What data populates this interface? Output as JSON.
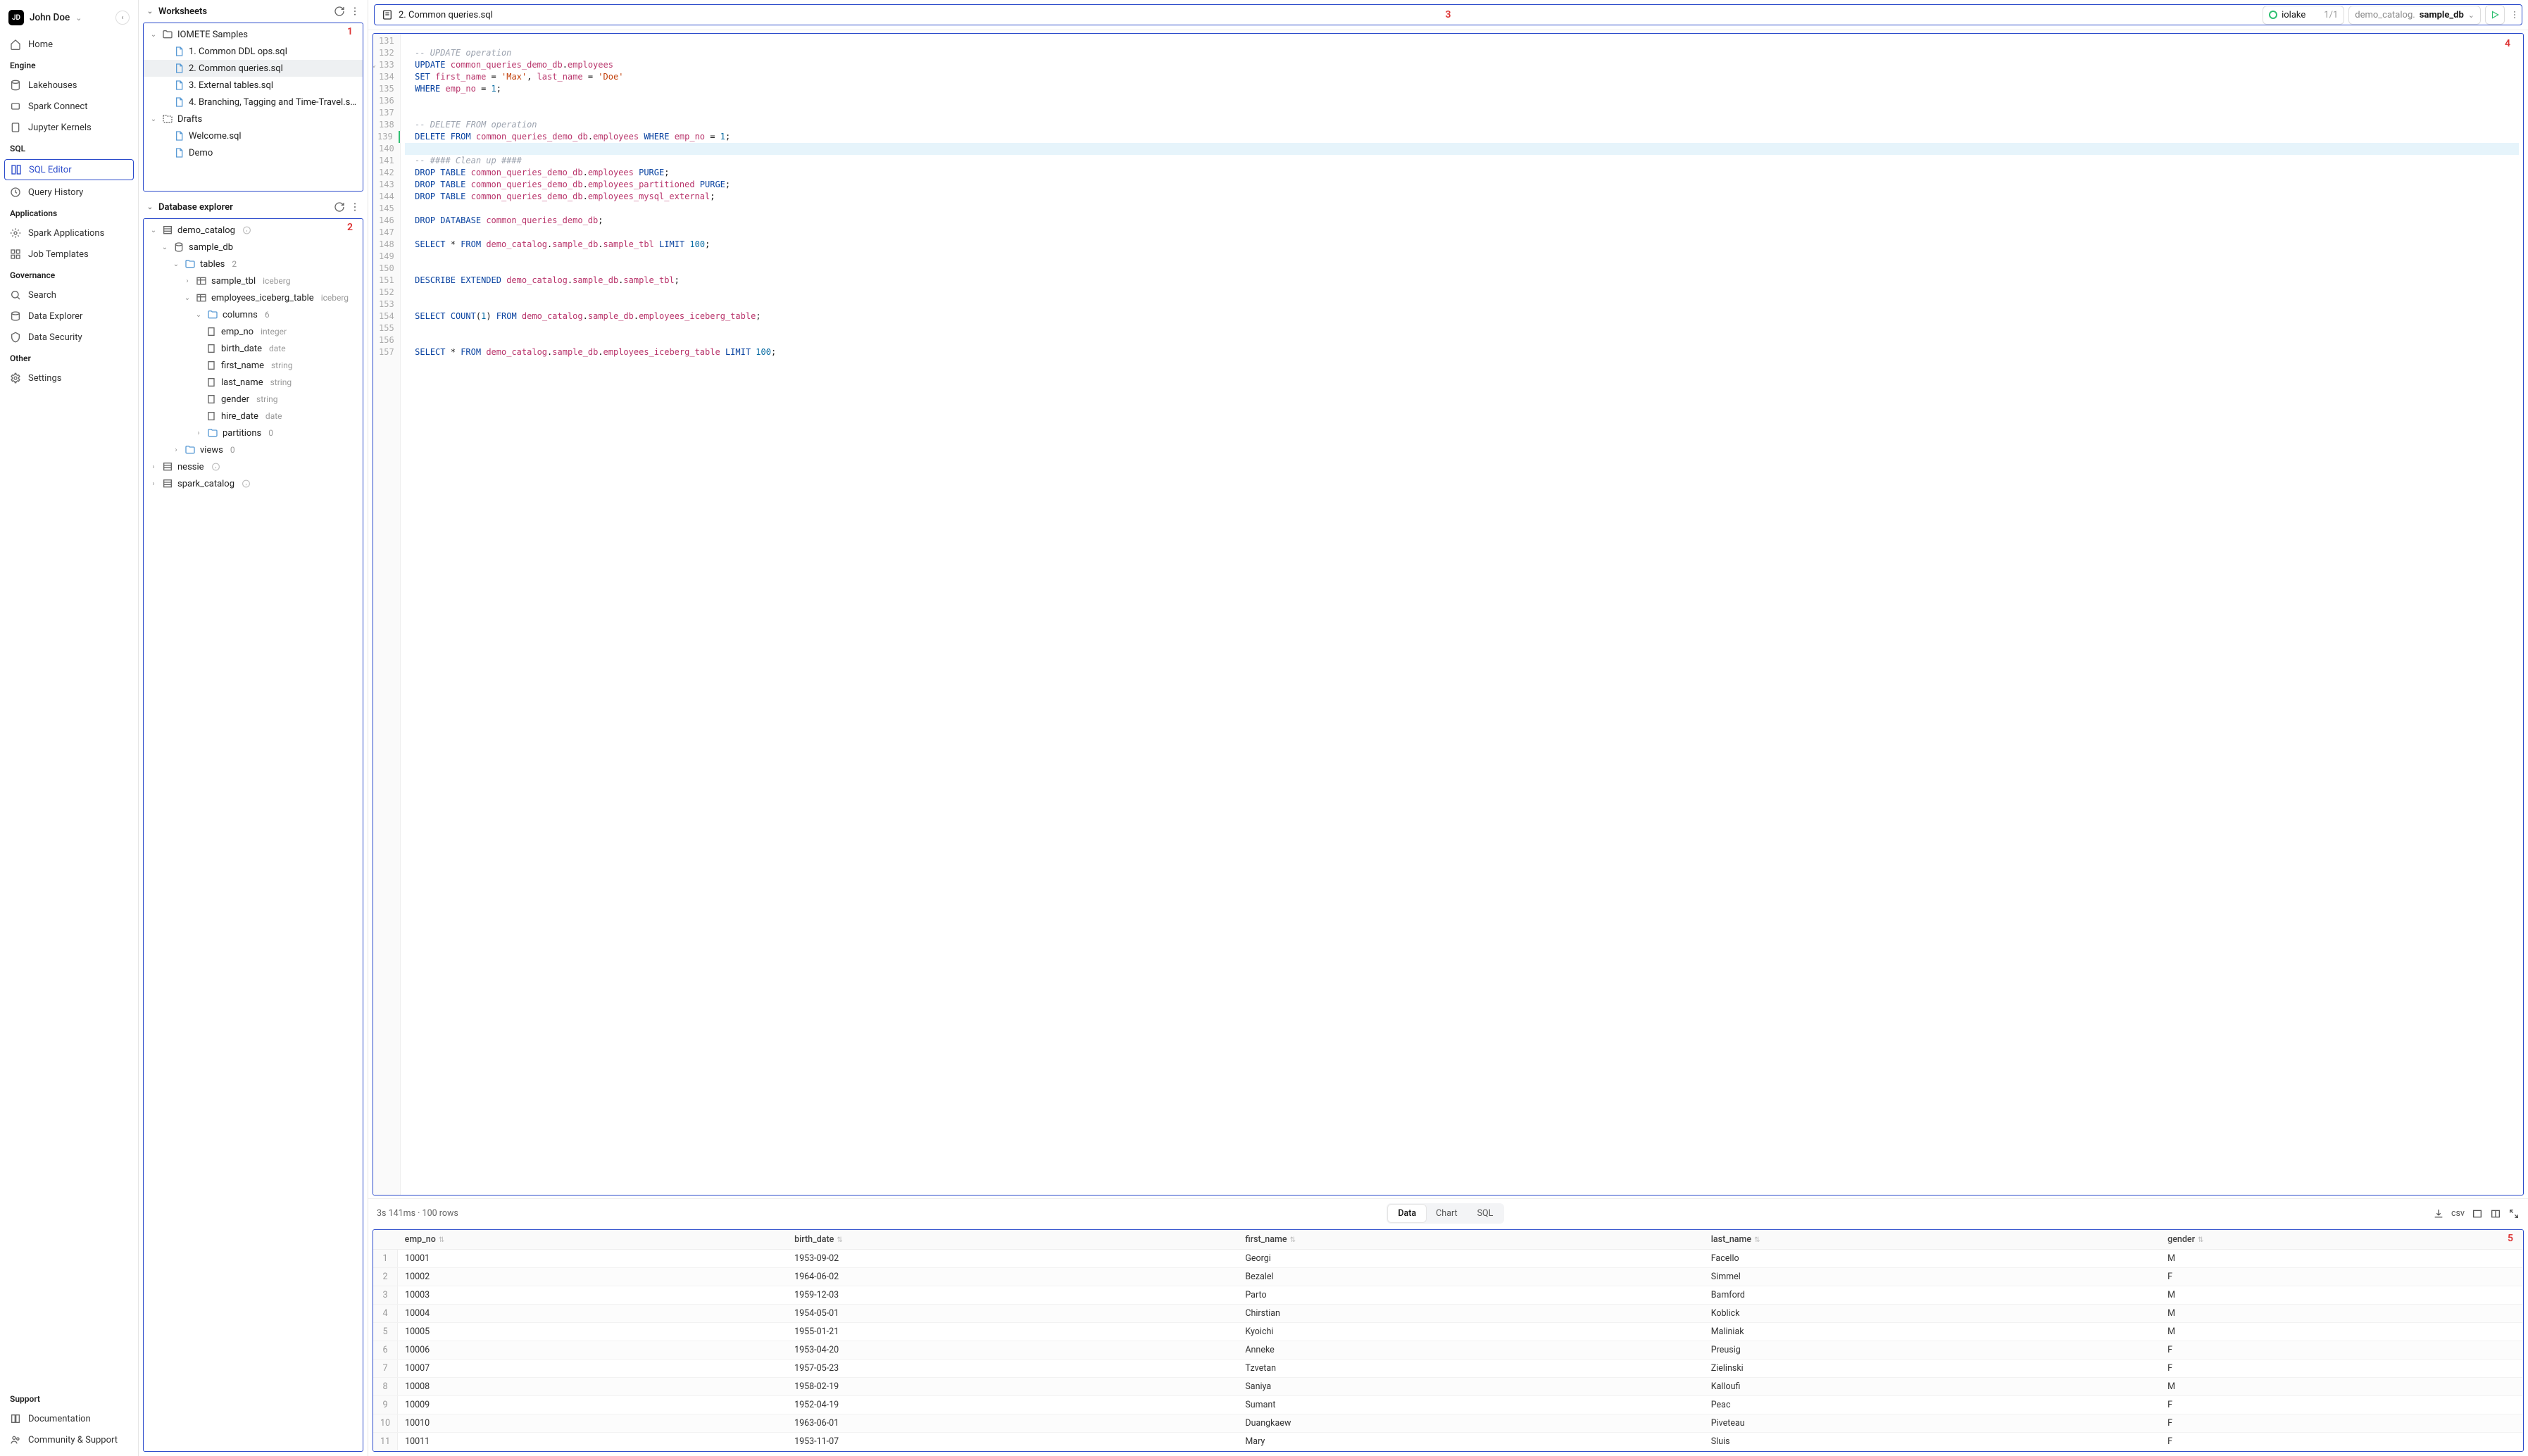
{
  "user": {
    "initials": "JD",
    "name": "John Doe"
  },
  "nav": {
    "home": "Home",
    "sections": {
      "engine": "Engine",
      "sql": "SQL",
      "applications": "Applications",
      "governance": "Governance",
      "other": "Other",
      "support": "Support"
    },
    "items": {
      "lakehouses": "Lakehouses",
      "spark_connect": "Spark Connect",
      "jupyter": "Jupyter Kernels",
      "sql_editor": "SQL Editor",
      "query_history": "Query History",
      "spark_apps": "Spark Applications",
      "job_templates": "Job Templates",
      "search": "Search",
      "data_explorer": "Data Explorer",
      "data_security": "Data Security",
      "settings": "Settings",
      "documentation": "Documentation",
      "community": "Community & Support"
    }
  },
  "worksheets": {
    "title": "Worksheets",
    "annot": "1",
    "folder": "IOMETE Samples",
    "files": [
      "1. Common DDL ops.sql",
      "2. Common queries.sql",
      "3. External tables.sql",
      "4. Branching, Tagging and Time-Travel.sql"
    ],
    "drafts_label": "Drafts",
    "drafts": [
      "Welcome.sql",
      "Demo"
    ]
  },
  "dbexplorer": {
    "title": "Database explorer",
    "annot": "2",
    "catalogs": {
      "demo": "demo_catalog",
      "nessie": "nessie",
      "spark": "spark_catalog"
    },
    "db": "sample_db",
    "tables_label": "tables",
    "tables_count": "2",
    "sample_tbl": "sample_tbl",
    "sample_tbl_type": "iceberg",
    "emp_tbl": "employees_iceberg_table",
    "emp_tbl_type": "iceberg",
    "columns_label": "columns",
    "columns_count": "6",
    "cols": [
      {
        "n": "emp_no",
        "t": "integer"
      },
      {
        "n": "birth_date",
        "t": "date"
      },
      {
        "n": "first_name",
        "t": "string"
      },
      {
        "n": "last_name",
        "t": "string"
      },
      {
        "n": "gender",
        "t": "string"
      },
      {
        "n": "hire_date",
        "t": "date"
      }
    ],
    "partitions_label": "partitions",
    "partitions_count": "0",
    "views_label": "views",
    "views_count": "0"
  },
  "toolbar": {
    "active_file": "2. Common queries.sql",
    "annot": "3",
    "compute": "iolake",
    "compute_count": "1/1",
    "catalog_prefix": "demo_catalog.",
    "catalog_db": "sample_db"
  },
  "editor": {
    "annot": "4",
    "first_line": 131,
    "lines": [
      "",
      "  -- UPDATE operation",
      "  UPDATE common_queries_demo_db.employees",
      "  SET first_name = 'Max', last_name = 'Doe'",
      "  WHERE emp_no = 1;",
      "",
      "",
      "  -- DELETE FROM operation",
      "  DELETE FROM common_queries_demo_db.employees WHERE emp_no = 1;",
      "",
      "  -- #### Clean up ####",
      "  DROP TABLE common_queries_demo_db.employees PURGE;",
      "  DROP TABLE common_queries_demo_db.employees_partitioned PURGE;",
      "  DROP TABLE common_queries_demo_db.employees_mysql_external;",
      "",
      "  DROP DATABASE common_queries_demo_db;",
      "",
      "  SELECT * FROM demo_catalog.sample_db.sample_tbl LIMIT 100;",
      "",
      "",
      "  DESCRIBE EXTENDED demo_catalog.sample_db.sample_tbl;",
      "",
      "",
      "  SELECT COUNT(1) FROM demo_catalog.sample_db.employees_iceberg_table;",
      "",
      "",
      "  SELECT * FROM demo_catalog.sample_db.employees_iceberg_table LIMIT 100;"
    ],
    "fold_lines": [
      133
    ],
    "cursor_line": 139,
    "highlight_line": 140
  },
  "results": {
    "timing": "3s 141ms",
    "rowcount": "100 rows",
    "tabs": {
      "data": "Data",
      "chart": "Chart",
      "sql": "SQL"
    },
    "export_label": "csv",
    "annot": "5",
    "columns": [
      "emp_no",
      "birth_date",
      "first_name",
      "last_name",
      "gender"
    ],
    "rows": [
      [
        "10001",
        "1953-09-02",
        "Georgi",
        "Facello",
        "M"
      ],
      [
        "10002",
        "1964-06-02",
        "Bezalel",
        "Simmel",
        "F"
      ],
      [
        "10003",
        "1959-12-03",
        "Parto",
        "Bamford",
        "M"
      ],
      [
        "10004",
        "1954-05-01",
        "Chirstian",
        "Koblick",
        "M"
      ],
      [
        "10005",
        "1955-01-21",
        "Kyoichi",
        "Maliniak",
        "M"
      ],
      [
        "10006",
        "1953-04-20",
        "Anneke",
        "Preusig",
        "F"
      ],
      [
        "10007",
        "1957-05-23",
        "Tzvetan",
        "Zielinski",
        "F"
      ],
      [
        "10008",
        "1958-02-19",
        "Saniya",
        "Kalloufi",
        "M"
      ],
      [
        "10009",
        "1952-04-19",
        "Sumant",
        "Peac",
        "F"
      ],
      [
        "10010",
        "1963-06-01",
        "Duangkaew",
        "Piveteau",
        "F"
      ],
      [
        "10011",
        "1953-11-07",
        "Mary",
        "Sluis",
        "F"
      ]
    ]
  }
}
